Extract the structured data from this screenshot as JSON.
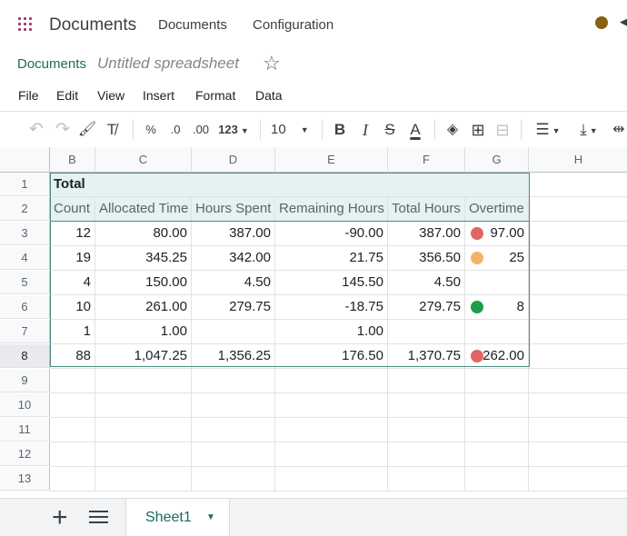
{
  "app": {
    "title": "Documents",
    "nav": [
      "Documents",
      "Configuration"
    ],
    "user_color": "#8a6014",
    "accent_color": "#1a6b5f"
  },
  "document": {
    "breadcrumb": "Documents",
    "name": "Untitled spreadsheet"
  },
  "menu": [
    "File",
    "Edit",
    "View",
    "Insert",
    "Format",
    "Data"
  ],
  "toolbar": {
    "undo_icon": "↶",
    "redo_icon": "↷",
    "paint_format_icon": "🖌",
    "clear_format_icon": "T̸",
    "percent": "%",
    "decrease_decimal": ".0",
    "increase_decimal": ".00",
    "number_format": "123",
    "font_size": "10",
    "bold": "B",
    "italic": "I",
    "strike": "S",
    "text_color": "A",
    "fill_icon": "◈",
    "borders_icon": "⊞",
    "merge_icon": "⊟",
    "align_icon": "☰",
    "valign_icon": "⤓",
    "wrap_icon": "⇹"
  },
  "grid": {
    "columns": [
      "B",
      "C",
      "D",
      "E",
      "F",
      "G",
      "H"
    ],
    "rows": [
      "1",
      "2",
      "3",
      "4",
      "5",
      "6",
      "7",
      "8",
      "9",
      "10",
      "11",
      "12",
      "13"
    ],
    "selected_row": "8",
    "table_title": "Total",
    "headers": [
      "Count",
      "Allocated Time",
      "Hours Spent",
      "Remaining Hours",
      "Total Hours",
      "Overtime"
    ],
    "data": [
      {
        "count": "12",
        "allocated": "80.00",
        "spent": "387.00",
        "remaining": "-90.00",
        "total": "387.00",
        "overtime": "97.00",
        "status": "red"
      },
      {
        "count": "19",
        "allocated": "345.25",
        "spent": "342.00",
        "remaining": "21.75",
        "total": "356.50",
        "overtime": "25",
        "status": "orange"
      },
      {
        "count": "4",
        "allocated": "150.00",
        "spent": "4.50",
        "remaining": "145.50",
        "total": "4.50",
        "overtime": "",
        "status": ""
      },
      {
        "count": "10",
        "allocated": "261.00",
        "spent": "279.75",
        "remaining": "-18.75",
        "total": "279.75",
        "overtime": "8",
        "status": "green"
      },
      {
        "count": "1",
        "allocated": "1.00",
        "spent": "",
        "remaining": "1.00",
        "total": "",
        "overtime": "",
        "status": ""
      },
      {
        "count": "88",
        "allocated": "1,047.25",
        "spent": "1,356.25",
        "remaining": "176.50",
        "total": "1,370.75",
        "overtime": "262.00",
        "status": "red"
      }
    ],
    "status_colors": {
      "red": "#e06666",
      "orange": "#f6b26b",
      "green": "#1e9e4a"
    }
  },
  "sheets": {
    "add_icon": "+",
    "tabs": [
      {
        "label": "Sheet1"
      }
    ]
  }
}
